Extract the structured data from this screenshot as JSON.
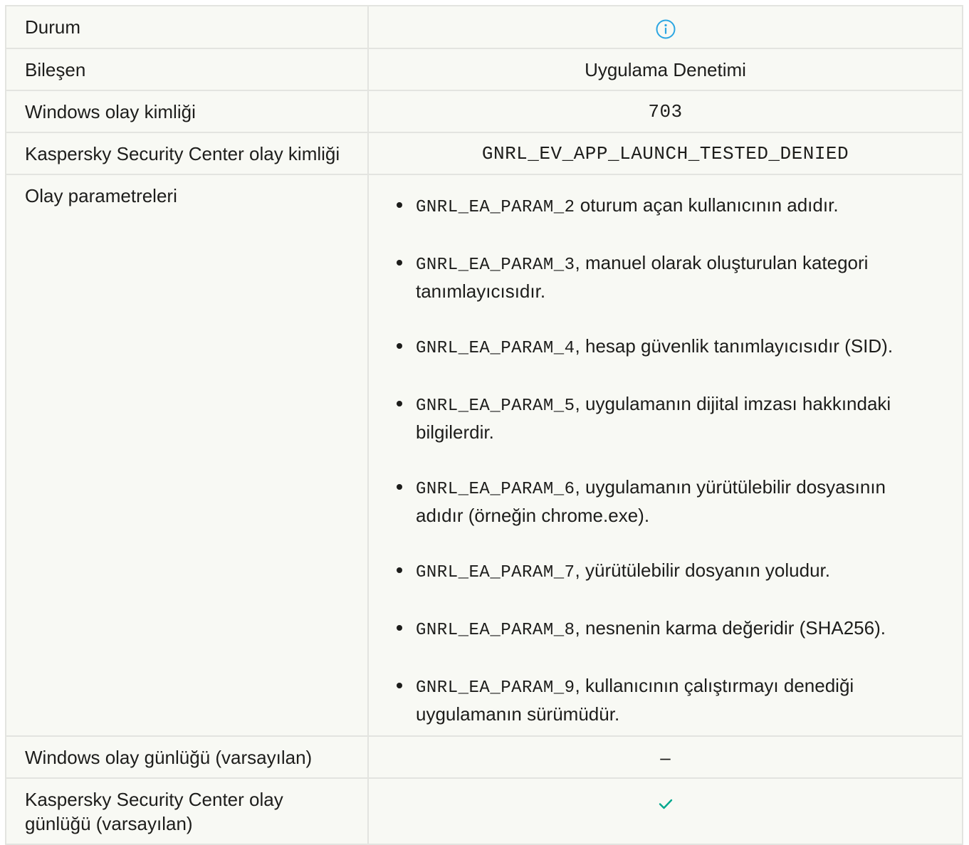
{
  "rows": {
    "status": {
      "label": "Durum",
      "icon": "info-icon",
      "icon_color": "#2ba6e2"
    },
    "component": {
      "label": "Bileşen",
      "value": "Uygulama Denetimi"
    },
    "windows_event_id": {
      "label": "Windows olay kimliği",
      "value": "703"
    },
    "ksc_event_id": {
      "label": "Kaspersky Security Center olay kimliği",
      "value": "GNRL_EV_APP_LAUNCH_TESTED_DENIED"
    },
    "event_params": {
      "label": "Olay parametreleri",
      "items": [
        {
          "code": "GNRL_EA_PARAM_2",
          "text": " oturum açan kullanıcının adıdır."
        },
        {
          "code": "GNRL_EA_PARAM_3",
          "text": ", manuel olarak oluşturulan kategori tanımlayıcısıdır."
        },
        {
          "code": "GNRL_EA_PARAM_4",
          "text": ", hesap güvenlik tanımlayıcısıdır (SID)."
        },
        {
          "code": "GNRL_EA_PARAM_5",
          "text": ", uygulamanın dijital imzası hakkındaki bilgilerdir."
        },
        {
          "code": "GNRL_EA_PARAM_6",
          "text": ", uygulamanın yürütülebilir dosyasının adıdır (örneğin chrome.exe)."
        },
        {
          "code": "GNRL_EA_PARAM_7",
          "text": ", yürütülebilir dosyanın yoludur."
        },
        {
          "code": "GNRL_EA_PARAM_8",
          "text": ", nesnenin karma değeridir (SHA256)."
        },
        {
          "code": "GNRL_EA_PARAM_9",
          "text": ", kullanıcının çalıştırmayı denediği uygulamanın sürümüdür."
        }
      ]
    },
    "windows_log": {
      "label": "Windows olay günlüğü (varsayılan)",
      "value": "–"
    },
    "ksc_log": {
      "label": "Kaspersky Security Center olay günlüğü (varsayılan)",
      "icon": "check-icon",
      "icon_color": "#00a88e"
    }
  }
}
